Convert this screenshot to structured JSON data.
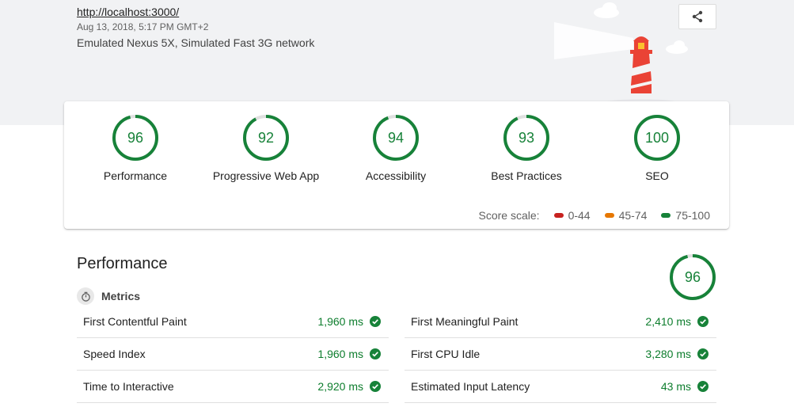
{
  "header": {
    "url": "http://localhost:3000/",
    "date": "Aug 13, 2018, 5:17 PM GMT+2",
    "device": "Emulated Nexus 5X, Simulated Fast 3G network",
    "share_icon": "share-icon"
  },
  "summary": {
    "gauges": [
      {
        "score": "96",
        "label": "Performance",
        "value": 96
      },
      {
        "score": "92",
        "label": "Progressive Web App",
        "value": 92
      },
      {
        "score": "94",
        "label": "Accessibility",
        "value": 94
      },
      {
        "score": "93",
        "label": "Best Practices",
        "value": 93
      },
      {
        "score": "100",
        "label": "SEO",
        "value": 100
      }
    ],
    "scale": {
      "label": "Score scale:",
      "ranges": [
        {
          "label": "0-44",
          "color": "#c7221f"
        },
        {
          "label": "45-74",
          "color": "#e67700"
        },
        {
          "label": "75-100",
          "color": "#178239"
        }
      ]
    }
  },
  "performance": {
    "title": "Performance",
    "score": "96",
    "value": 96,
    "metrics_label": "Metrics",
    "metrics": [
      {
        "name": "First Contentful Paint",
        "value": "1,960 ms"
      },
      {
        "name": "First Meaningful Paint",
        "value": "2,410 ms"
      },
      {
        "name": "Speed Index",
        "value": "1,960 ms"
      },
      {
        "name": "First CPU Idle",
        "value": "3,280 ms"
      },
      {
        "name": "Time to Interactive",
        "value": "2,920 ms"
      },
      {
        "name": "Estimated Input Latency",
        "value": "43 ms"
      }
    ]
  },
  "colors": {
    "pass": "#178239",
    "pass_text": "#0d7d2d",
    "band": "#f1f2f4"
  }
}
